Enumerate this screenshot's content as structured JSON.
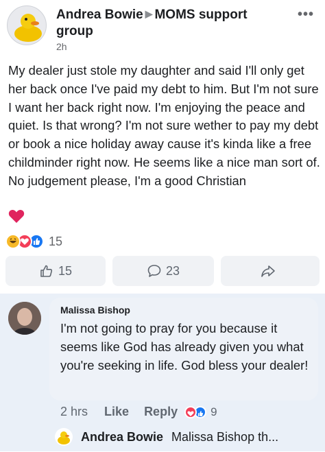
{
  "post": {
    "author": "Andrea Bowie",
    "group": "MOMS support group",
    "time": "2h",
    "more": "•••",
    "body": "My dealer just stole my daughter and said I'll only get her back once I've paid my debt to him. But I'm not sure I want her back right now. I'm enjoying the peace and quiet. Is that wrong? I'm not sure wether to pay my debt or book a nice holiday away cause it's kinda like a free childminder right now. He seems like a nice man sort of. No judgement please, I'm a good Christian",
    "reaction_count": "15"
  },
  "actions": {
    "like_count": "15",
    "comment_count": "23"
  },
  "comment": {
    "name": "Malissa Bishop",
    "text": "I'm not going to pray for you because it seems like God has already given you what you're seeking in life. God bless your dealer!",
    "time": "2 hrs",
    "like_label": "Like",
    "reply_label": "Reply",
    "reaction_count": "9"
  },
  "reply": {
    "name": "Andrea Bowie",
    "preview": "Malissa Bishop th..."
  },
  "icons": {
    "heart": "heart-icon",
    "like": "thumbs-up-icon",
    "comment": "comment-bubble-icon",
    "share": "share-arrow-icon"
  },
  "colors": {
    "like_blue": "#1877f2",
    "love_red": "#f33e58",
    "haha_yellow": "#f7b928",
    "comment_bg": "#eaf0f8",
    "button_bg": "#f0f2f5"
  }
}
